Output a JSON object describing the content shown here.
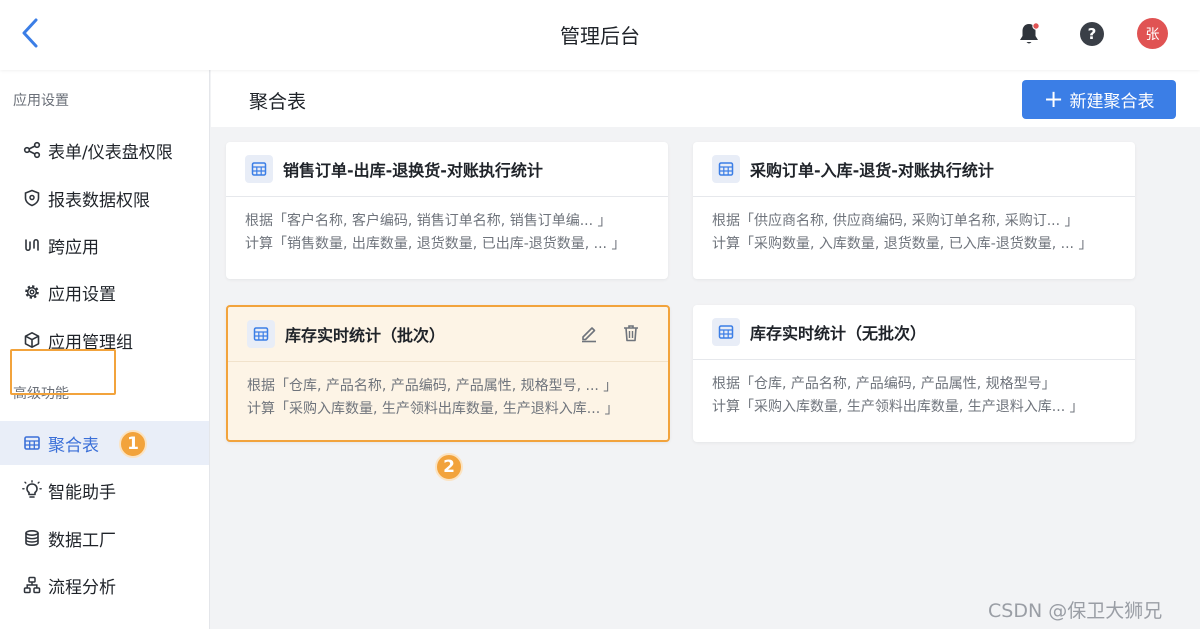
{
  "header": {
    "title": "管理后台",
    "avatar_initial": "张",
    "help_glyph": "?",
    "back_icon": "chevron-left-icon",
    "bell_icon": "bell-icon",
    "accent_color": "#3b7ee6",
    "badge_color": "#e05353"
  },
  "sidebar": {
    "section_app": "应用设置",
    "items_app": [
      {
        "label": "表单/仪表盘权限",
        "icon": "share-nodes-icon"
      },
      {
        "label": "报表数据权限",
        "icon": "shield-icon"
      },
      {
        "label": "跨应用",
        "icon": "link-icon"
      },
      {
        "label": "应用设置",
        "icon": "gear-icon"
      },
      {
        "label": "应用管理组",
        "icon": "cube-icon"
      }
    ],
    "section_adv": "高级功能",
    "items_adv": [
      {
        "label": "聚合表",
        "icon": "table-icon",
        "active": true
      },
      {
        "label": "智能助手",
        "icon": "lightbulb-icon"
      },
      {
        "label": "数据工厂",
        "icon": "database-icon"
      },
      {
        "label": "流程分析",
        "icon": "flow-icon"
      }
    ]
  },
  "markers": [
    "1",
    "2"
  ],
  "main": {
    "title": "聚合表",
    "new_button_label": "新建聚合表",
    "cards": [
      {
        "title": "销售订单-出库-退换货-对账执行统计",
        "line1": "根据「客户名称, 客户编码, 销售订单名称, 销售订单编...  」",
        "line2": "计算「销售数量, 出库数量, 退货数量, 已出库-退货数量, ... 」"
      },
      {
        "title": "采购订单-入库-退货-对账执行统计",
        "line1": "根据「供应商名称, 供应商编码, 采购订单名称, 采购订...  」",
        "line2": "计算「采购数量, 入库数量, 退货数量, 已入库-退货数量, ... 」"
      },
      {
        "title": "库存实时统计（批次）",
        "line1": "根据「仓库, 产品名称, 产品编码, 产品属性, 规格型号, ...   」",
        "line2": "计算「采购入库数量, 生产领料出库数量, 生产退料入库...  」",
        "hovered": true
      },
      {
        "title": "库存实时统计（无批次）",
        "line1": "根据「仓库, 产品名称, 产品编码, 产品属性, 规格型号」",
        "line2": "计算「采购入库数量, 生产领料出库数量, 生产退料入库...  」"
      }
    ]
  },
  "watermark": "CSDN @保卫大狮兄"
}
